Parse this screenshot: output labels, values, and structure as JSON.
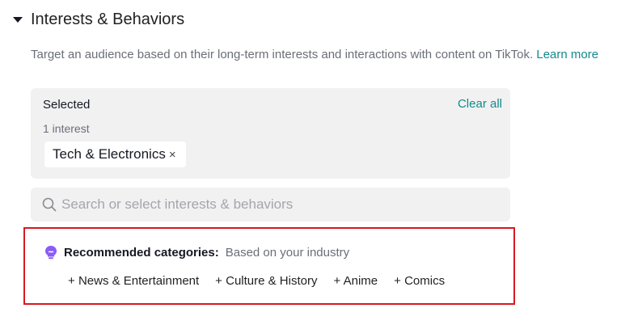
{
  "section": {
    "title": "Interests & Behaviors",
    "description": "Target an audience based on their long-term interests and interactions with content on TikTok.",
    "learn_more": "Learn more"
  },
  "selected": {
    "label": "Selected",
    "clear_all": "Clear all",
    "count": "1 interest",
    "chips": [
      {
        "label": "Tech & Electronics",
        "remove": "×"
      }
    ]
  },
  "search": {
    "placeholder": "Search or select interests & behaviors",
    "value": ""
  },
  "recommended": {
    "title": "Recommended categories:",
    "subtitle": "Based on your industry",
    "items": [
      {
        "prefix": "+",
        "label": "News & Entertainment"
      },
      {
        "prefix": "+",
        "label": "Culture & History"
      },
      {
        "prefix": "+",
        "label": "Anime"
      },
      {
        "prefix": "+",
        "label": "Comics"
      }
    ],
    "icon": "lightbulb-icon",
    "icon_color": "#8b5cf6",
    "highlight_color": "#d71920"
  },
  "colors": {
    "accent": "#128a8a",
    "panel_bg": "#f1f1f2"
  }
}
